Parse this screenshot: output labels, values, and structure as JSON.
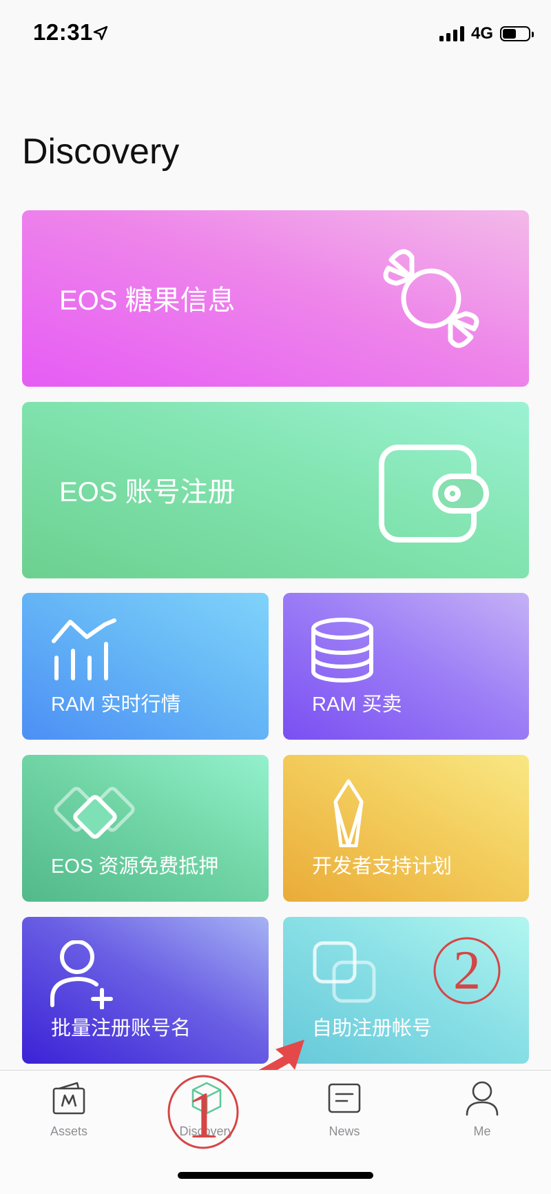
{
  "status_bar": {
    "time": "12:31",
    "network": "4G",
    "battery_level": 0.55
  },
  "page": {
    "title": "Discovery"
  },
  "cards": {
    "candy": {
      "label": "EOS 糖果信息",
      "icon": "candy-icon"
    },
    "register": {
      "label": "EOS 账号注册",
      "icon": "wallet-icon"
    },
    "ram_market": {
      "label": "RAM 实时行情",
      "icon": "chart-icon"
    },
    "ram_trade": {
      "label": "RAM 买卖",
      "icon": "database-icon"
    },
    "resource": {
      "label": "EOS 资源免费抵押",
      "icon": "diamond-stack-icon"
    },
    "developer": {
      "label": "开发者支持计划",
      "icon": "eos-logo-icon"
    },
    "batch": {
      "label": "批量注册账号名",
      "icon": "add-user-icon"
    },
    "self_register": {
      "label": "自助注册帐号",
      "icon": "overlap-squares-icon"
    }
  },
  "annotations": {
    "marker_1": "1",
    "marker_2": "2",
    "annotation_color": "#d64545"
  },
  "tab_bar": {
    "tabs": [
      {
        "label": "Assets",
        "icon": "assets-icon"
      },
      {
        "label": "Discovery",
        "icon": "cube-icon",
        "active": true
      },
      {
        "label": "News",
        "icon": "news-icon"
      },
      {
        "label": "Me",
        "icon": "user-icon"
      }
    ]
  },
  "colors": {
    "candy_gradient": [
      "#e65cf5",
      "#f3b9e9"
    ],
    "register_gradient": [
      "#6cd090",
      "#9cf2d4"
    ],
    "ram_market_gradient": [
      "#4c8ff5",
      "#7fd3fa"
    ],
    "ram_trade_gradient": [
      "#7a4ff2",
      "#c5b1f6"
    ],
    "resource_gradient": [
      "#52b98b",
      "#93f1cd"
    ],
    "developer_gradient": [
      "#eaab38",
      "#f9e783"
    ],
    "batch_gradient": [
      "#3b22d6",
      "#a6b2f4"
    ],
    "self_register_gradient": [
      "#66c9d9",
      "#b2f6f0"
    ],
    "tab_inactive": "#8e8e93"
  }
}
